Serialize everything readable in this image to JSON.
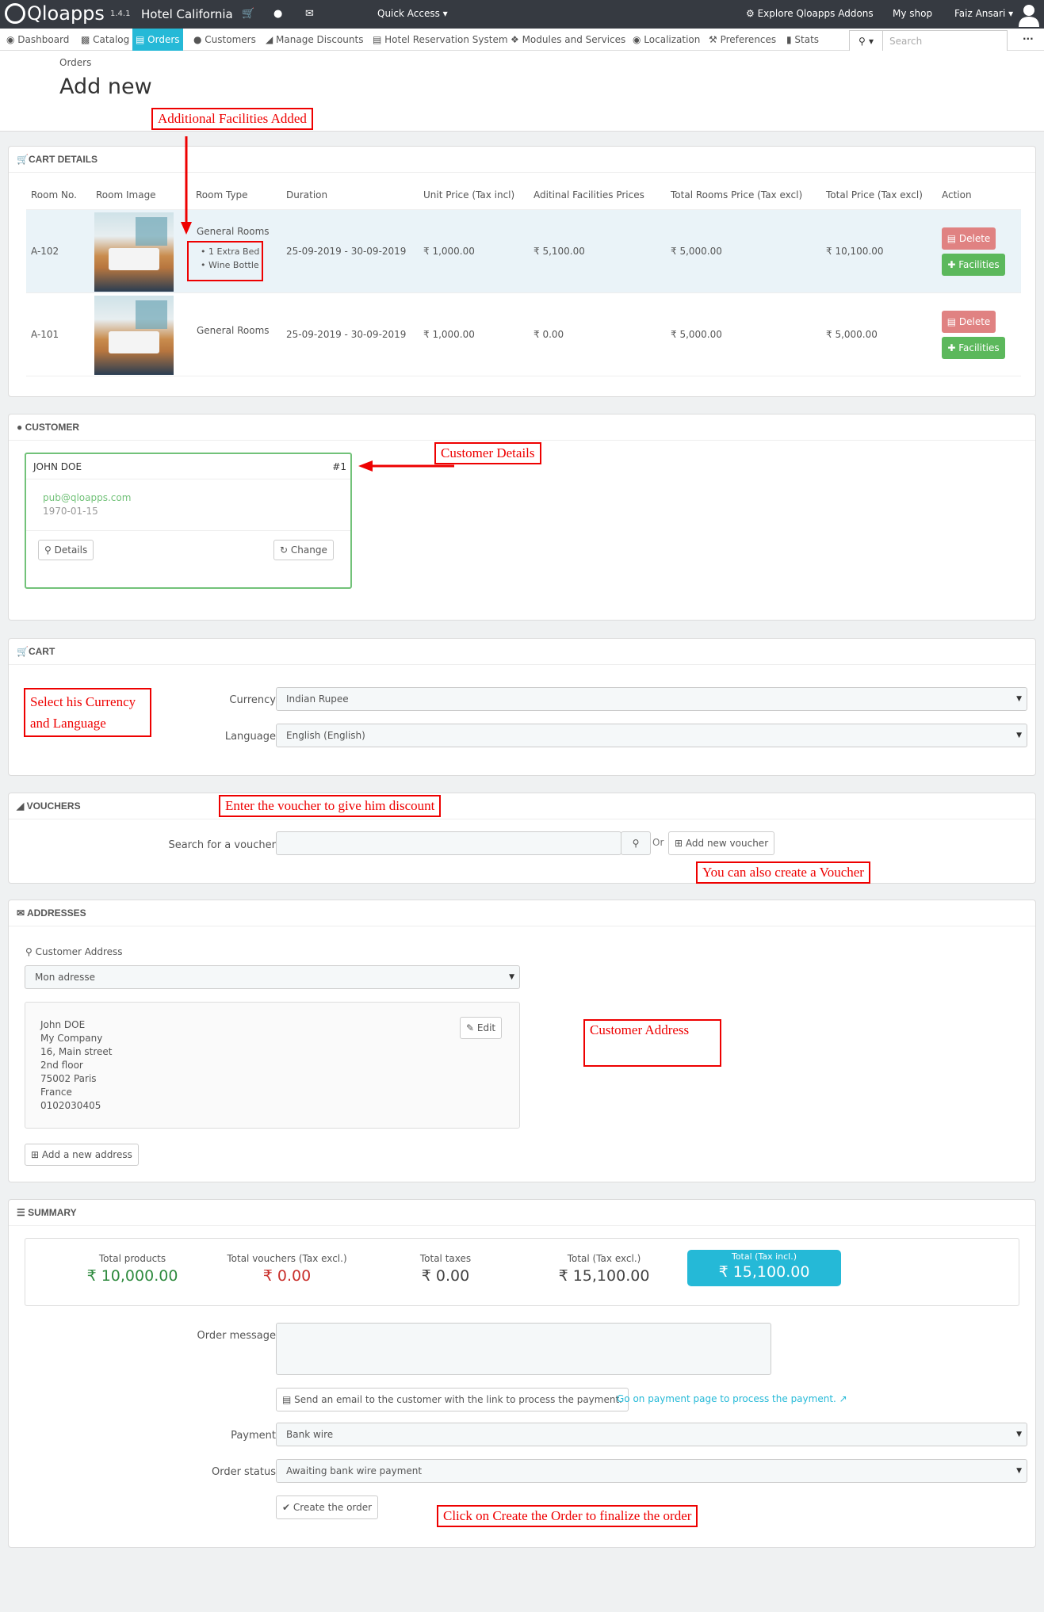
{
  "topbar": {
    "brand": "Qloapps",
    "version": "1.4.1",
    "shop_name": "Hotel California",
    "quick_access": "Quick Access",
    "explore": "Explore Qloapps Addons",
    "my_shop": "My shop",
    "user": "Faiz Ansari"
  },
  "nav": {
    "items": [
      "Dashboard",
      "Catalog",
      "Orders",
      "Customers",
      "Manage Discounts",
      "Hotel Reservation System",
      "Modules and Services",
      "Localization",
      "Preferences",
      "Stats"
    ],
    "search_placeholder": "Search"
  },
  "page": {
    "breadcrumb": "Orders",
    "title": "Add new"
  },
  "cart_details": {
    "heading": "Cart Details",
    "columns": [
      "Room No.",
      "Room Image",
      "Room Type",
      "Duration",
      "Unit Price (Tax incl)",
      "Aditinal Facilities Prices",
      "Total Rooms Price (Tax excl)",
      "Total Price (Tax excl)",
      "Action"
    ],
    "rows": [
      {
        "room_no": "A-102",
        "room_type": "General Rooms",
        "facilities": [
          "1 Extra Bed",
          "Wine Bottle"
        ],
        "duration": "25-09-2019 -  30-09-2019",
        "unit_price": "₹ 1,000.00",
        "facilities_price": "₹ 5,100.00",
        "rooms_price": "₹ 5,000.00",
        "total_price": "₹ 10,100.00"
      },
      {
        "room_no": "A-101",
        "room_type": "General Rooms",
        "facilities": [],
        "duration": "25-09-2019 -  30-09-2019",
        "unit_price": "₹ 1,000.00",
        "facilities_price": "₹ 0.00",
        "rooms_price": "₹ 5,000.00",
        "total_price": "₹ 5,000.00"
      }
    ],
    "delete_label": "Delete",
    "facilities_label": "Facilities"
  },
  "customer": {
    "heading": "Customer",
    "name": "JOHN DOE",
    "id": "#1",
    "email": "pub@qloapps.com",
    "birthdate": "1970-01-15",
    "details_label": "Details",
    "change_label": "Change"
  },
  "cart": {
    "heading": "Cart",
    "currency_label": "Currency",
    "currency_value": "Indian Rupee",
    "language_label": "Language",
    "language_value": "English (English)"
  },
  "vouchers": {
    "heading": "Vouchers",
    "search_label": "Search for a voucher",
    "or_label": "Or",
    "add_label": "Add new voucher"
  },
  "addresses": {
    "heading": "Addresses",
    "customer_address_label": "Customer Address",
    "selected": "Mon adresse",
    "lines": [
      "John DOE",
      "My Company",
      "16, Main street",
      "2nd floor",
      "75002 Paris",
      "France",
      "0102030405"
    ],
    "edit_label": "Edit",
    "add_label": "Add a new address"
  },
  "summary": {
    "heading": "Summary",
    "total_products_label": "Total products",
    "total_products": "₹ 10,000.00",
    "total_vouchers_label": "Total vouchers (Tax excl.)",
    "total_vouchers": "₹ 0.00",
    "total_taxes_label": "Total taxes",
    "total_taxes": "₹ 0.00",
    "total_excl_label": "Total (Tax excl.)",
    "total_excl": "₹ 15,100.00",
    "total_incl_label": "Total (Tax incl.)",
    "total_incl": "₹ 15,100.00",
    "order_message_label": "Order message",
    "send_email_label": "Send an email to the customer with the link to process the payment.",
    "payment_link": "Go on payment page to process the payment.",
    "payment_label": "Payment",
    "payment_value": "Bank wire",
    "status_label": "Order status",
    "status_value": "Awaiting bank wire payment",
    "create_label": "Create the order"
  },
  "annotations": {
    "facilities": "Additional Facilities Added",
    "customer": "Customer Details",
    "currency": "Select his Currency and Language",
    "voucher": "Enter the voucher to give him discount",
    "create_voucher": "You can also create a Voucher",
    "address": "Customer Address",
    "create_order": "Click on Create the Order to finalize the order"
  },
  "colors": {
    "accent": "#25b9d7",
    "annotation": "#e00000",
    "success": "#5cb85c",
    "danger": "#e08282",
    "topbar": "#363a41"
  }
}
